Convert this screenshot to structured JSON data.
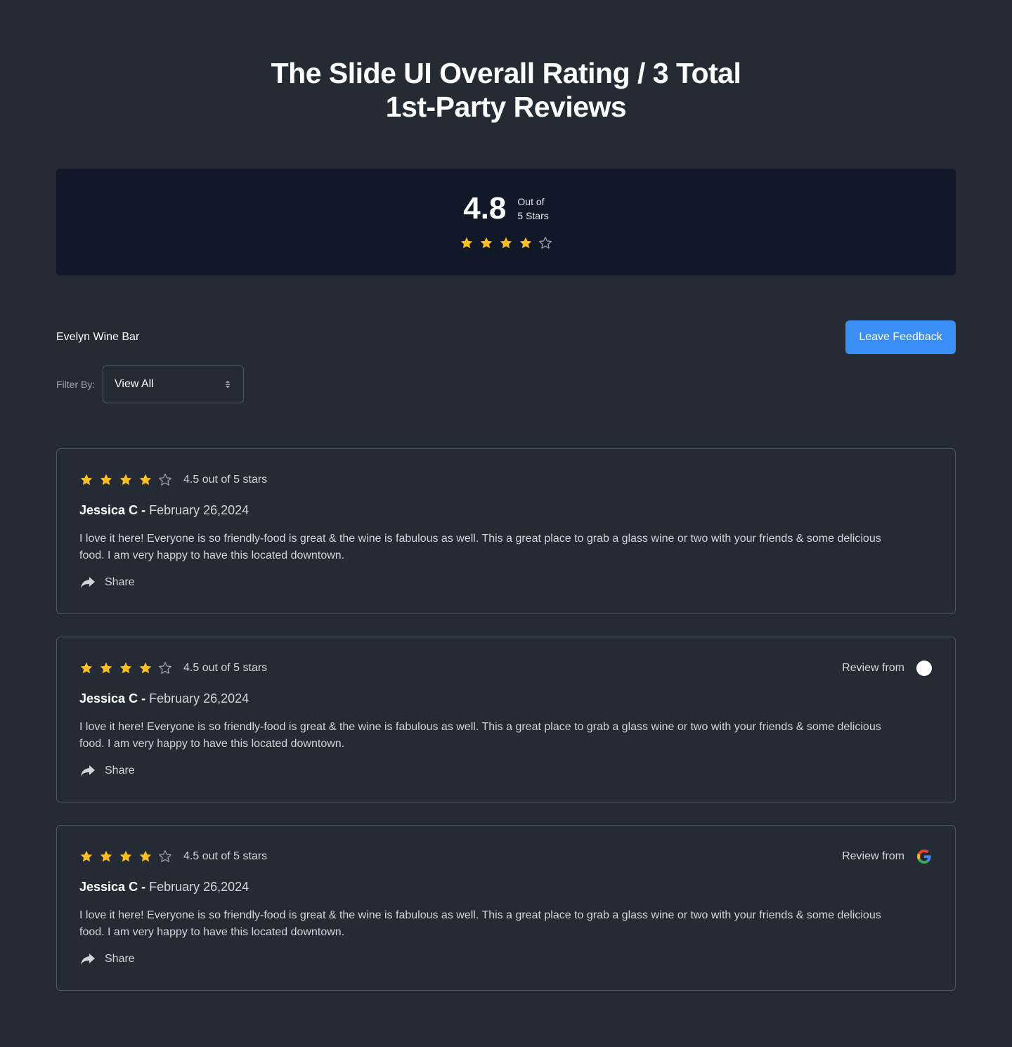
{
  "header": {
    "title_line1": "The Slide UI Overall Rating / 3 Total",
    "title_line2": "1st-Party Reviews"
  },
  "summary": {
    "average": "4.8",
    "out_of_line1": "Out of",
    "out_of_line2": "5 Stars",
    "stars_filled": 4,
    "stars_total": 5
  },
  "business": {
    "name": "Evelyn Wine Bar"
  },
  "actions": {
    "leave_feedback_label": "Leave Feedback"
  },
  "filter": {
    "label": "Filter By:",
    "selected": "View All"
  },
  "reviews": [
    {
      "stars_filled": 4,
      "score_text": "4.5 out of 5 stars",
      "author": "Jessica C",
      "separator": " - ",
      "date": "February 26,2024",
      "body": "I love it here! Everyone is so friendly-food is great & the wine is fabulous as well. This a great place to grab a glass wine or two with your friends & some delicious food. I am very happy to have this located downtown.",
      "share_label": "Share"
    },
    {
      "stars_filled": 4,
      "score_text": "4.5 out of 5 stars",
      "author": "Jessica C",
      "separator": " - ",
      "date": "February 26,2024",
      "body": "I love it here! Everyone is so friendly-food is great & the wine is fabulous as well. This a great place to grab a glass wine or two with your friends & some delicious food. I am very happy to have this located downtown.",
      "share_label": "Share",
      "review_from_label": "Review from",
      "source_icon": "white-circle-icon"
    },
    {
      "stars_filled": 4,
      "score_text": "4.5 out of 5 stars",
      "author": "Jessica C",
      "separator": " - ",
      "date": "February 26,2024",
      "body": "I love it here! Everyone is so friendly-food is great & the wine is fabulous as well. This a great place to grab a glass wine or two with your friends & some delicious food. I am very happy to have this located downtown.",
      "share_label": "Share",
      "review_from_label": "Review from",
      "source_icon": "google-icon"
    }
  ],
  "colors": {
    "background": "#252b34",
    "summary_panel": "#111827",
    "star_filled": "#fbbf24",
    "star_empty": "#9ca3af",
    "button": "#3b8ef5",
    "border": "#4b5563"
  }
}
